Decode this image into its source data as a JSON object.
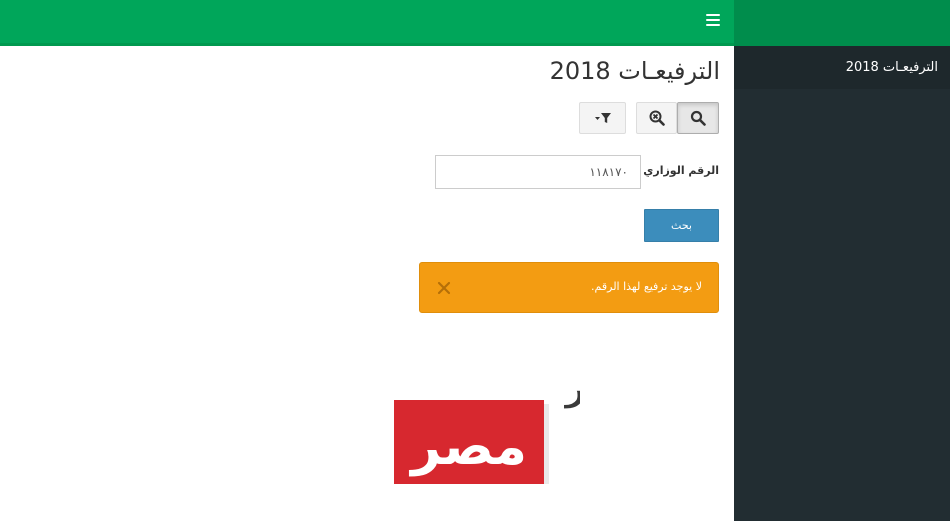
{
  "header": {
    "menu_icon": "hamburger-menu-icon",
    "bar_color": "#00a65a",
    "brand_color": "#008d4c"
  },
  "sidebar": {
    "items": [
      {
        "label": "الترفيعـات 2018"
      }
    ],
    "bg_color": "#222d32"
  },
  "main": {
    "title": "الترفيعـات 2018",
    "toolbar": {
      "search_icon": "search-icon",
      "zoom_clear_icon": "zoom-clear-icon",
      "filter_icon": "filter-dropdown-icon"
    },
    "form": {
      "label": "الرقم الوزاري",
      "input_value": "١١٨١٧٠",
      "submit_label": "بحث"
    },
    "alert": {
      "message": "لا يوجد ترفيع لهذا الرقم.",
      "close_icon": "close-icon",
      "color": "#f39c12"
    },
    "watermark": {
      "line1": "مباشر",
      "line2": "مصر",
      "red": "#d7282f"
    }
  }
}
